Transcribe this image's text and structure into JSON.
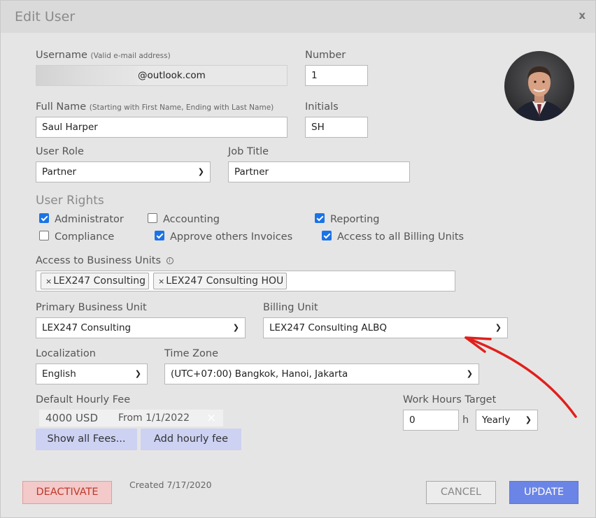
{
  "dialog": {
    "title": "Edit User",
    "close": "x"
  },
  "username": {
    "label": "Username",
    "hint": "(Valid e-mail address)",
    "value": "@outlook.com"
  },
  "number": {
    "label": "Number",
    "value": "1"
  },
  "fullname": {
    "label": "Full Name",
    "hint": "(Starting with First Name, Ending with Last Name)",
    "value": "Saul Harper"
  },
  "initials": {
    "label": "Initials",
    "value": "SH"
  },
  "user_role": {
    "label": "User Role",
    "value": "Partner"
  },
  "job_title": {
    "label": "Job Title",
    "value": "Partner"
  },
  "user_rights": {
    "label": "User Rights",
    "items": [
      {
        "label": "Administrator",
        "checked": true
      },
      {
        "label": "Accounting",
        "checked": false
      },
      {
        "label": "Reporting",
        "checked": true
      },
      {
        "label": "Compliance",
        "checked": false
      },
      {
        "label": "Approve others Invoices",
        "checked": true
      },
      {
        "label": "Access to all Billing Units",
        "checked": true
      }
    ]
  },
  "business_units": {
    "label": "Access to Business Units",
    "info_icon": "info-icon",
    "tags": [
      "LEX247 Consulting",
      "LEX247 Consulting HOU"
    ],
    "remove_symbol": "×"
  },
  "primary_bu": {
    "label": "Primary Business Unit",
    "value": "LEX247 Consulting"
  },
  "billing_unit": {
    "label": "Billing Unit",
    "value": "LEX247 Consulting ALBQ"
  },
  "localization": {
    "label": "Localization",
    "value": "English"
  },
  "timezone": {
    "label": "Time Zone",
    "value": "(UTC+07:00) Bangkok, Hanoi, Jakarta"
  },
  "hourly_fee": {
    "label": "Default Hourly Fee",
    "amount": "4000 USD",
    "from": "From 1/1/2022",
    "remove": "×",
    "show_all": "Show all Fees...",
    "add": "Add hourly fee"
  },
  "work_hours": {
    "label": "Work Hours Target",
    "value": "0",
    "unit": "h",
    "period": "Yearly"
  },
  "footer": {
    "deactivate": "DEACTIVATE",
    "created": "Created 7/17/2020",
    "cancel": "CANCEL",
    "update": "UPDATE"
  },
  "colors": {
    "update_bg": "#6b85e6",
    "deactivate_bg": "#f3c9c9",
    "fee_button_bg": "#cdd2f3",
    "annotation_arrow": "#e0201c",
    "checkbox": "#1a73e8"
  }
}
